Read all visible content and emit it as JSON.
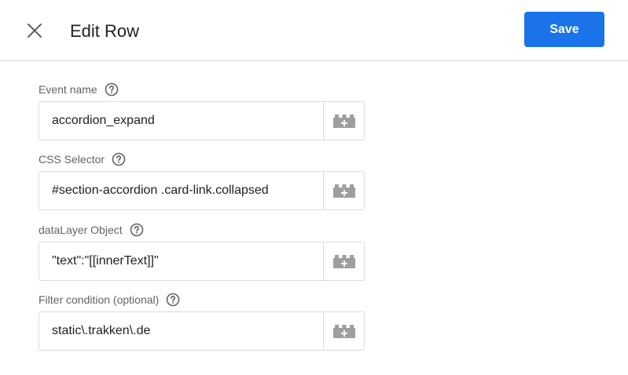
{
  "header": {
    "title": "Edit Row",
    "save_label": "Save",
    "close_icon": "close-icon"
  },
  "fields": [
    {
      "label": "Event name",
      "value": "accordion_expand"
    },
    {
      "label": "CSS Selector",
      "value": "#section-accordion .card-link.collapsed"
    },
    {
      "label": "dataLayer Object",
      "value": "\"text\":\"[[innerText]]\""
    },
    {
      "label": "Filter condition (optional)",
      "value": "static\\.trakken\\.de"
    }
  ],
  "icons": {
    "help": "help-circle-icon",
    "variable": "add-variable-icon"
  },
  "colors": {
    "accent": "#1a73e8",
    "border": "#dadce0",
    "label": "#5f6368",
    "icon": "#9e9e9e"
  }
}
